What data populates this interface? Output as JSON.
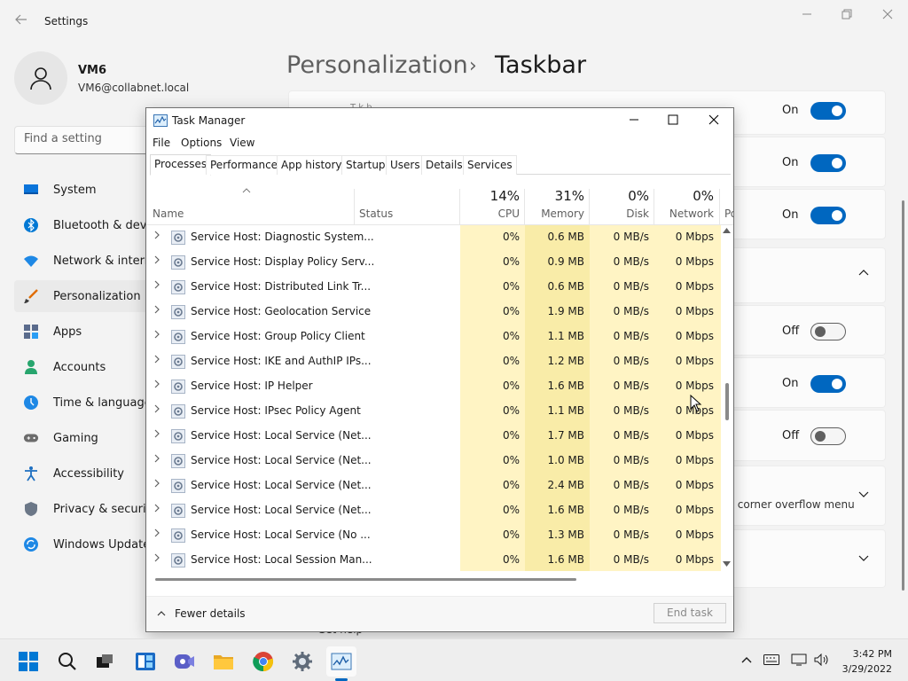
{
  "settings": {
    "title": "Settings",
    "profile": {
      "name": "VM6",
      "email": "VM6@collabnet.local"
    },
    "search": {
      "placeholder": "Find a setting"
    },
    "nav": [
      {
        "label": "System",
        "icon": "monitor-icon",
        "active": false
      },
      {
        "label": "Bluetooth & devices",
        "icon": "bluetooth-icon",
        "active": false
      },
      {
        "label": "Network & internet",
        "icon": "wifi-icon",
        "active": false
      },
      {
        "label": "Personalization",
        "icon": "brush-icon",
        "active": true
      },
      {
        "label": "Apps",
        "icon": "apps-icon",
        "active": false
      },
      {
        "label": "Accounts",
        "icon": "person-icon",
        "active": false
      },
      {
        "label": "Time & language",
        "icon": "clock-globe-icon",
        "active": false
      },
      {
        "label": "Gaming",
        "icon": "gamepad-icon",
        "active": false
      },
      {
        "label": "Accessibility",
        "icon": "accessibility-icon",
        "active": false
      },
      {
        "label": "Privacy & security",
        "icon": "shield-icon",
        "active": false
      },
      {
        "label": "Windows Update",
        "icon": "update-icon",
        "active": false
      }
    ],
    "breadcrumb": {
      "parent": "Personalization",
      "separator": "›",
      "current": "Taskbar"
    },
    "toggles": [
      {
        "label": "On",
        "state": "on"
      },
      {
        "label": "On",
        "state": "on"
      },
      {
        "label": "On",
        "state": "on"
      },
      {
        "label": "Off",
        "state": "off"
      },
      {
        "label": "On",
        "state": "on"
      },
      {
        "label": "Off",
        "state": "off"
      }
    ],
    "partial_text": {
      "overflow": "r corner overflow menu",
      "top_fragment": "T  k   b",
      "bottom_fragment": "Get help"
    },
    "accent_color": "#0067c0"
  },
  "taskmanager": {
    "title": "Task Manager",
    "menu": [
      "File",
      "Options",
      "View"
    ],
    "tabs": [
      "Processes",
      "Performance",
      "App history",
      "Startup",
      "Users",
      "Details",
      "Services"
    ],
    "active_tab": "Processes",
    "columns": {
      "name": "Name",
      "status": "Status",
      "cpu": {
        "label": "CPU",
        "total": "14%"
      },
      "memory": {
        "label": "Memory",
        "total": "31%"
      },
      "disk": {
        "label": "Disk",
        "total": "0%"
      },
      "network": {
        "label": "Network",
        "total": "0%"
      },
      "power": "Po"
    },
    "rows": [
      {
        "name": "Service Host: Diagnostic System...",
        "cpu": "0%",
        "memory": "0.6 MB",
        "disk": "0 MB/s",
        "network": "0 Mbps"
      },
      {
        "name": "Service Host: Display Policy Serv...",
        "cpu": "0%",
        "memory": "0.9 MB",
        "disk": "0 MB/s",
        "network": "0 Mbps"
      },
      {
        "name": "Service Host: Distributed Link Tr...",
        "cpu": "0%",
        "memory": "0.6 MB",
        "disk": "0 MB/s",
        "network": "0 Mbps"
      },
      {
        "name": "Service Host: Geolocation Service",
        "cpu": "0%",
        "memory": "1.9 MB",
        "disk": "0 MB/s",
        "network": "0 Mbps"
      },
      {
        "name": "Service Host: Group Policy Client",
        "cpu": "0%",
        "memory": "1.1 MB",
        "disk": "0 MB/s",
        "network": "0 Mbps"
      },
      {
        "name": "Service Host: IKE and AuthIP IPs...",
        "cpu": "0%",
        "memory": "1.2 MB",
        "disk": "0 MB/s",
        "network": "0 Mbps"
      },
      {
        "name": "Service Host: IP Helper",
        "cpu": "0%",
        "memory": "1.6 MB",
        "disk": "0 MB/s",
        "network": "0 Mbps"
      },
      {
        "name": "Service Host: IPsec Policy Agent",
        "cpu": "0%",
        "memory": "1.1 MB",
        "disk": "0 MB/s",
        "network": "0 Mbps"
      },
      {
        "name": "Service Host: Local Service (Net...",
        "cpu": "0%",
        "memory": "1.7 MB",
        "disk": "0 MB/s",
        "network": "0 Mbps"
      },
      {
        "name": "Service Host: Local Service (Net...",
        "cpu": "0%",
        "memory": "1.0 MB",
        "disk": "0 MB/s",
        "network": "0 Mbps"
      },
      {
        "name": "Service Host: Local Service (Net...",
        "cpu": "0%",
        "memory": "2.4 MB",
        "disk": "0 MB/s",
        "network": "0 Mbps"
      },
      {
        "name": "Service Host: Local Service (Net...",
        "cpu": "0%",
        "memory": "1.6 MB",
        "disk": "0 MB/s",
        "network": "0 Mbps"
      },
      {
        "name": "Service Host: Local Service (No ...",
        "cpu": "0%",
        "memory": "1.3 MB",
        "disk": "0 MB/s",
        "network": "0 Mbps"
      },
      {
        "name": "Service Host: Local Session Man...",
        "cpu": "0%",
        "memory": "1.6 MB",
        "disk": "0 MB/s",
        "network": "0 Mbps"
      }
    ],
    "footer": {
      "fewer_details": "Fewer details",
      "end_task": "End task"
    },
    "heat_colors": {
      "light": "#fff4c4",
      "memory": "#f9eca8"
    }
  },
  "taskbar": {
    "apps": [
      "start-icon",
      "search-icon",
      "task-view-icon",
      "widgets-icon",
      "chat-icon",
      "file-explorer-icon",
      "chrome-icon",
      "settings-icon",
      "task-manager-icon"
    ],
    "clock": {
      "time": "3:42 PM",
      "date": "3/29/2022"
    }
  }
}
